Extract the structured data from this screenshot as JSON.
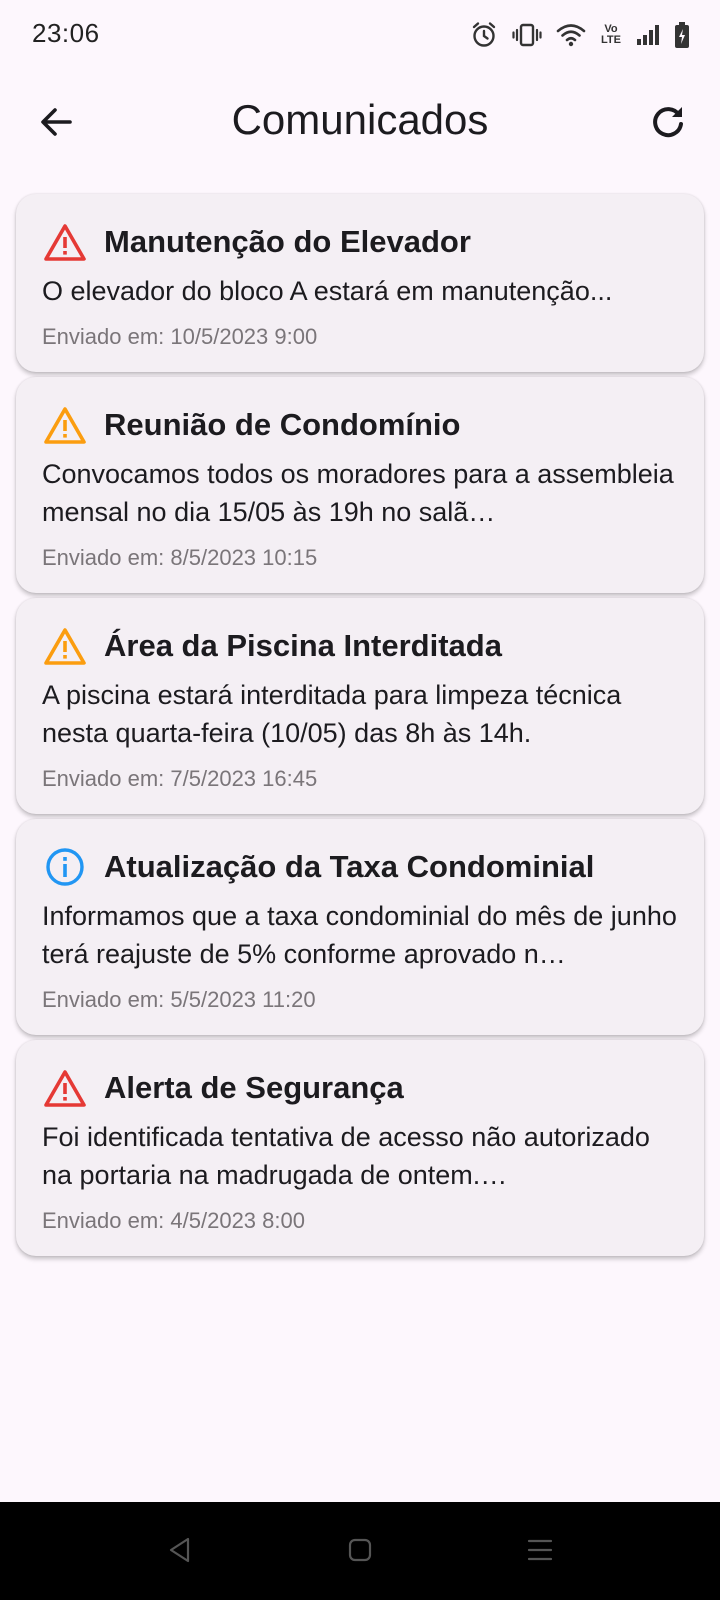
{
  "status_bar": {
    "time": "23:06",
    "icons": [
      "alarm-icon",
      "vibrate-icon",
      "wifi-icon",
      "volte-icon",
      "signal-icon",
      "battery-icon"
    ],
    "volte_label": "Vo LTE"
  },
  "app_bar": {
    "title": "Comunicados",
    "back_icon": "arrow-back-icon",
    "refresh_icon": "refresh-icon"
  },
  "colors": {
    "background": "#fdf7fd",
    "card": "#f4eff4",
    "danger": "#e53935",
    "warning": "#fb9d0f",
    "info": "#2196f3",
    "muted": "#7a7579"
  },
  "notices": [
    {
      "title": "Manutenção do Elevador",
      "body": "O elevador do bloco A estará em manutenção...",
      "date": "Enviado em: 10/5/2023 9:00",
      "severity": "danger",
      "icon": "warning-triangle-icon"
    },
    {
      "title": "Reunião de Condomínio",
      "body": "Convocamos todos os moradores para a assembleia mensal no dia 15/05 às 19h no salã…",
      "date": "Enviado em: 8/5/2023 10:15",
      "severity": "warning",
      "icon": "warning-triangle-icon"
    },
    {
      "title": "Área da Piscina Interditada",
      "body": "A piscina estará interditada para limpeza técnica nesta quarta-feira (10/05) das 8h às 14h.",
      "date": "Enviado em: 7/5/2023 16:45",
      "severity": "warning",
      "icon": "warning-triangle-icon"
    },
    {
      "title": "Atualização da Taxa Condominial",
      "body": "Informamos que a taxa condominial do mês de junho terá reajuste de 5% conforme aprovado n…",
      "date": "Enviado em: 5/5/2023 11:20",
      "severity": "info",
      "icon": "info-circle-icon"
    },
    {
      "title": "Alerta de Segurança",
      "body": "Foi identificada tentativa de acesso não autorizado na portaria na madrugada de ontem.…",
      "date": "Enviado em: 4/5/2023 8:00",
      "severity": "danger",
      "icon": "warning-triangle-icon"
    }
  ],
  "nav_bar": {
    "icons": [
      "back-nav-icon",
      "home-nav-icon",
      "recents-nav-icon"
    ]
  }
}
